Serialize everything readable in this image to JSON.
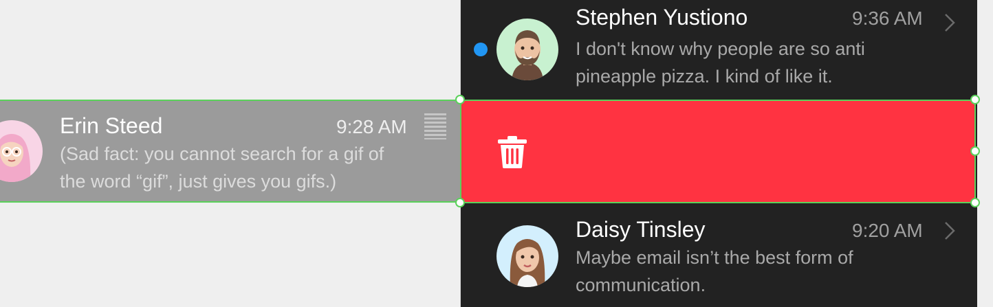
{
  "messages": [
    {
      "name": "Stephen Yustiono",
      "time": "9:36 AM",
      "preview_line1": "I don't know why people are so anti",
      "preview_line2": "pineapple pizza. I kind of like it.",
      "unread": true,
      "avatar_bg": "#c8f1d0"
    },
    {
      "name": "Erin Steed",
      "time": "9:28 AM",
      "preview_line1": "(Sad fact: you cannot search for a gif of",
      "preview_line2": "the word “gif”, just gives you gifs.)",
      "unread": false,
      "avatar_bg": "#f8d5e6"
    },
    {
      "name": "Daisy Tinsley",
      "time": "9:20 AM",
      "preview_line1": "Maybe email isn’t the best form of",
      "preview_line2": "communication.",
      "unread": false,
      "avatar_bg": "#d3effd"
    }
  ],
  "swipe_action": {
    "icon": "trash-icon",
    "color": "#ff3341"
  },
  "colors": {
    "panel_bg": "#222222",
    "dragged_row_bg": "#9b9b9b",
    "selection_outline": "#5ad15a",
    "unread_dot": "#2196f3"
  }
}
